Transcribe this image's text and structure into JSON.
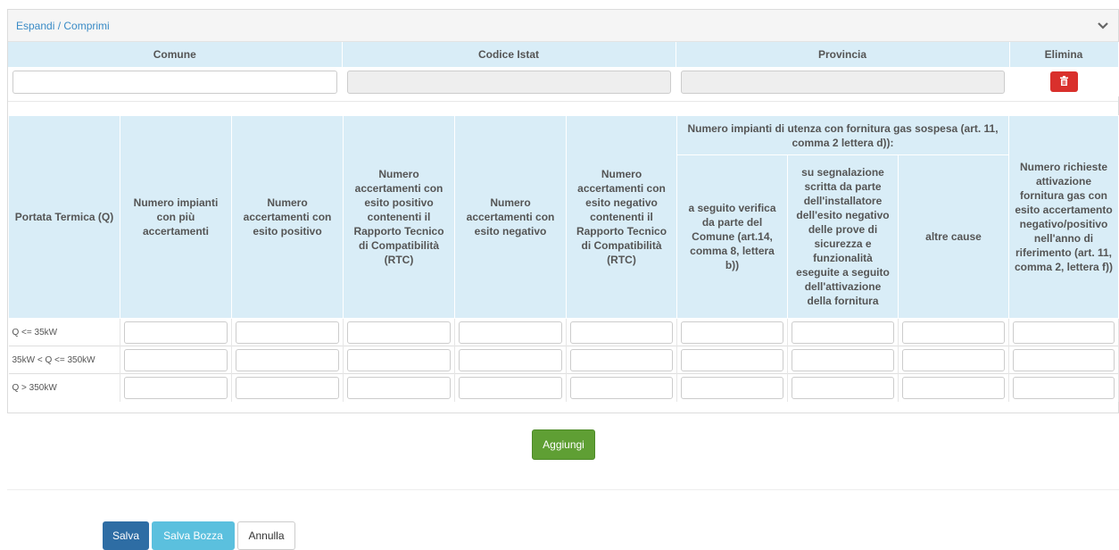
{
  "panel": {
    "toggle_label": "Espandi / Comprimi"
  },
  "comune_table": {
    "headers": {
      "comune": "Comune",
      "codice": "Codice Istat",
      "provincia": "Provincia",
      "elimina": "Elimina"
    },
    "row": {
      "comune_value": "",
      "codice_value": "",
      "provincia_value": ""
    }
  },
  "main_table": {
    "headers": {
      "portata": "Portata Termica (Q)",
      "impianti_piu": "Numero impianti con più accertamenti",
      "acc_positivo": "Numero accertamenti con esito positivo",
      "acc_positivo_rtc": "Numero accertamenti con esito positivo contenenti il Rapporto Tecnico di Compatibilità (RTC)",
      "acc_negativo": "Numero accertamenti con esito negativo",
      "acc_negativo_rtc": "Numero accertamenti con esito negativo contenenti il Rapporto Tecnico di Compatibilità (RTC)",
      "sospesa_group": "Numero impianti di utenza con fornitura gas sospesa (art. 11, comma 2 lettera d)):",
      "sospesa_verifica": "a seguito verifica da parte del Comune (art.14, comma 8, lettera b))",
      "sospesa_segnalazione": "su segnalazione scritta da parte dell'installatore dell'esito negativo delle prove di sicurezza e funzionalità eseguite a seguito dell'attivazione della fornitura",
      "sospesa_altre": "altre cause",
      "richieste": "Numero richieste attivazione fornitura gas con esito accertamento negativo/positivo nell'anno di riferimento (art. 11, comma 2, lettera f))"
    },
    "rows": [
      {
        "label": "Q <= 35kW"
      },
      {
        "label": "35kW < Q <= 350kW"
      },
      {
        "label": "Q > 350kW"
      }
    ]
  },
  "buttons": {
    "aggiungi": "Aggiungi",
    "salva": "Salva",
    "salva_bozza": "Salva Bozza",
    "annulla": "Annulla"
  },
  "colors": {
    "header_bg": "#d9edf7",
    "link": "#3a8bc6",
    "add_green": "#5f9f34",
    "delete_red": "#d9302c",
    "save_blue": "#2e6da4",
    "draft_blue": "#5bc0de"
  },
  "icons": {
    "collapse": "chevron-down-icon",
    "delete": "trash-icon"
  }
}
